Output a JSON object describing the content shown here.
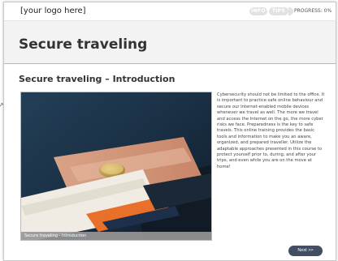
{
  "header": {
    "logo_text": "[your logo here]",
    "info_label": "INFO",
    "tips_label": "TIPS",
    "progress_label": "PROGRESS: 0%",
    "progress_value": 0
  },
  "page": {
    "title": "Secure traveling",
    "section_title": "Secure traveling – Introduction"
  },
  "media": {
    "caption": "Secure traveling - Introduction"
  },
  "content": {
    "body": "Cybersecurity should not be limited to the office. It is important to practice safe online behaviour and secure our Internet-enabled mobile devices whenever we travel as well. The more we travel and access the Internet on the go, the more cyber risks we face. Preparedness is the key to safe travels. This online training provides the basic tools and information to make you an aware, organized, and prepared traveller. Utilize the adaptable approaches presented in this course to protect yourself prior to, during, and after your trips, and even while you are on the move at home!"
  },
  "nav": {
    "next_label": "Next >>"
  },
  "colors": {
    "title_bar_bg": "#f3f3f3",
    "pill_bg": "#e2e2e2",
    "next_button_bg": "#424e63",
    "caption_bg": "#a0a0a0"
  },
  "icons": {
    "cursor": "mouse-pointer-icon"
  }
}
